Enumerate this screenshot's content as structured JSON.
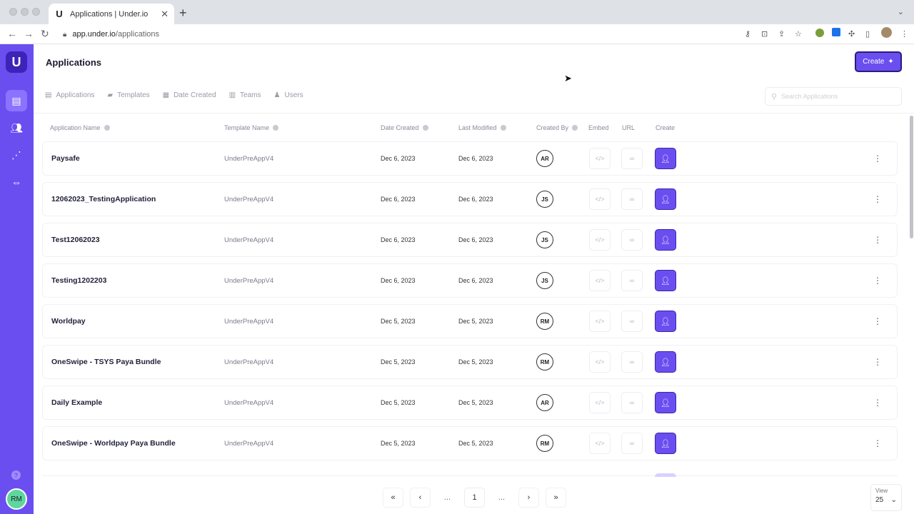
{
  "browser": {
    "tab_title": "Applications | Under.io",
    "tab_favicon": "U",
    "url_host": "app.under.io",
    "url_path": "/applications"
  },
  "app": {
    "logo": "U",
    "page_title": "Applications",
    "create_label": "Create",
    "user_initials": "RM",
    "help_label": "?"
  },
  "filters": [
    {
      "label": "Applications",
      "icon": "document-icon"
    },
    {
      "label": "Templates",
      "icon": "folder-icon"
    },
    {
      "label": "Date Created",
      "icon": "calendar-icon"
    },
    {
      "label": "Teams",
      "icon": "teams-icon"
    },
    {
      "label": "Users",
      "icon": "user-icon"
    }
  ],
  "search": {
    "placeholder": "Search Applications"
  },
  "table": {
    "headers": {
      "name": "Application Name",
      "template": "Template Name",
      "created": "Date Created",
      "modified": "Last Modified",
      "created_by": "Created By",
      "embed": "Embed",
      "url": "URL",
      "create": "Create"
    },
    "rows": [
      {
        "name": "Paysafe",
        "template": "UnderPreAppV4",
        "created": "Dec 6, 2023",
        "modified": "Dec 6, 2023",
        "by": "AR"
      },
      {
        "name": "12062023_TestingApplication",
        "template": "UnderPreAppV4",
        "created": "Dec 6, 2023",
        "modified": "Dec 6, 2023",
        "by": "JS"
      },
      {
        "name": "Test12062023",
        "template": "UnderPreAppV4",
        "created": "Dec 6, 2023",
        "modified": "Dec 6, 2023",
        "by": "JS"
      },
      {
        "name": "Testing1202203",
        "template": "UnderPreAppV4",
        "created": "Dec 6, 2023",
        "modified": "Dec 6, 2023",
        "by": "JS"
      },
      {
        "name": "Worldpay",
        "template": "UnderPreAppV4",
        "created": "Dec 5, 2023",
        "modified": "Dec 5, 2023",
        "by": "RM"
      },
      {
        "name": "OneSwipe - TSYS Paya Bundle",
        "template": "UnderPreAppV4",
        "created": "Dec 5, 2023",
        "modified": "Dec 5, 2023",
        "by": "RM"
      },
      {
        "name": "Daily Example",
        "template": "UnderPreAppV4",
        "created": "Dec 5, 2023",
        "modified": "Dec 5, 2023",
        "by": "AR"
      },
      {
        "name": "OneSwipe - Worldpay Paya Bundle",
        "template": "UnderPreAppV4",
        "created": "Dec 5, 2023",
        "modified": "Dec 5, 2023",
        "by": "RM"
      }
    ]
  },
  "pagination": {
    "first": "«",
    "prev": "‹",
    "ellipsis_left": "...",
    "current": "1",
    "ellipsis_right": "...",
    "next": "›",
    "last": "»"
  },
  "view": {
    "label": "View",
    "value": "25"
  },
  "colors": {
    "accent": "#6b4ef0",
    "sidebar": "#6b4ef0",
    "avatar_bg": "#5ed6a0"
  }
}
